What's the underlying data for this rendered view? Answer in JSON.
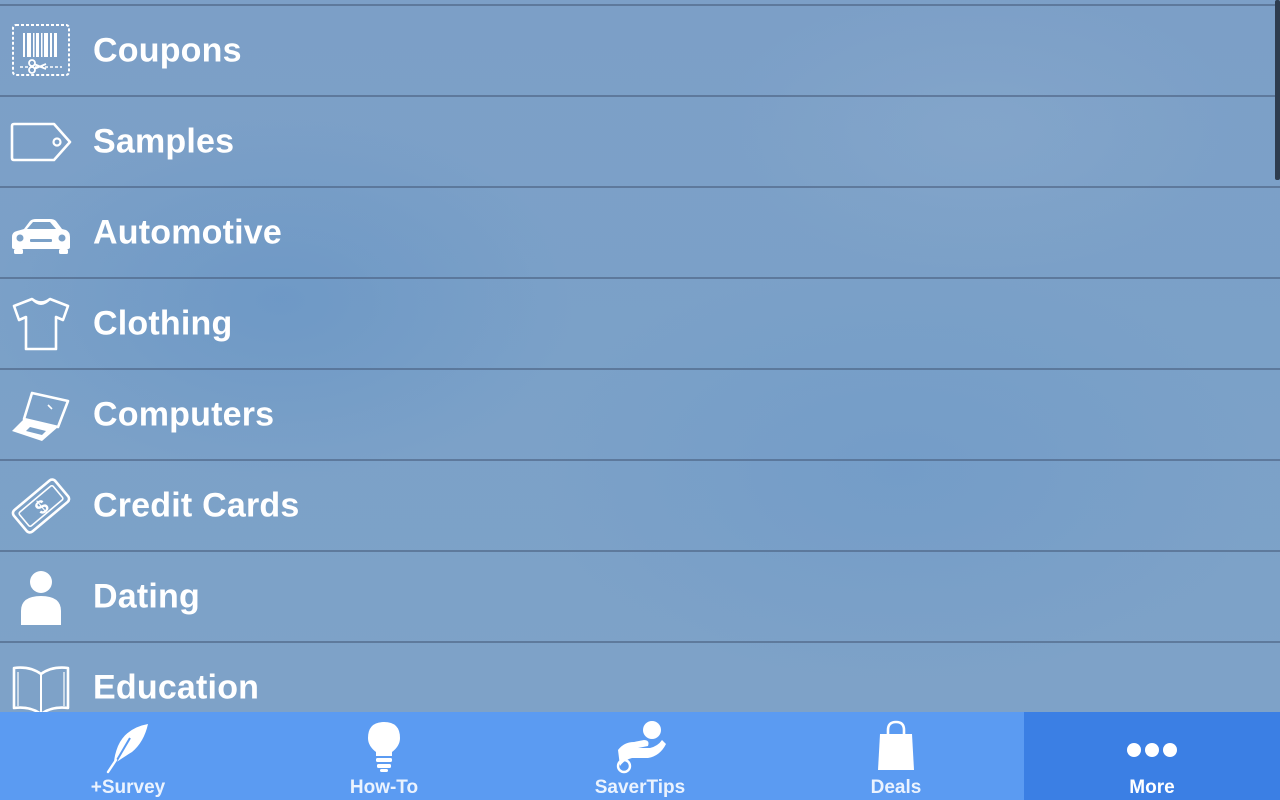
{
  "colors": {
    "list_background": "#7ba1c8",
    "row_divider": "#4a5a78",
    "text": "#ffffff",
    "tabbar_background": "#5b9bf2",
    "tab_active_background": "#3b7fe4"
  },
  "menu": {
    "items": [
      {
        "label": "Coupons",
        "icon": "barcode-coupon-icon"
      },
      {
        "label": "Samples",
        "icon": "tag-icon"
      },
      {
        "label": "Automotive",
        "icon": "car-icon"
      },
      {
        "label": "Clothing",
        "icon": "tshirt-icon"
      },
      {
        "label": "Computers",
        "icon": "laptop-icon"
      },
      {
        "label": "Credit Cards",
        "icon": "credit-card-dollar-icon"
      },
      {
        "label": "Dating",
        "icon": "person-icon"
      },
      {
        "label": "Education",
        "icon": "open-book-icon"
      }
    ]
  },
  "tabbar": {
    "tabs": [
      {
        "label": "+Survey",
        "icon": "feather-quill-icon",
        "active": false
      },
      {
        "label": "How-To",
        "icon": "lightbulb-icon",
        "active": false
      },
      {
        "label": "SaverTips",
        "icon": "hand-coin-icon",
        "active": false
      },
      {
        "label": "Deals",
        "icon": "shopping-bag-icon",
        "active": false
      },
      {
        "label": "More",
        "icon": "more-dots-icon",
        "active": true
      }
    ]
  }
}
